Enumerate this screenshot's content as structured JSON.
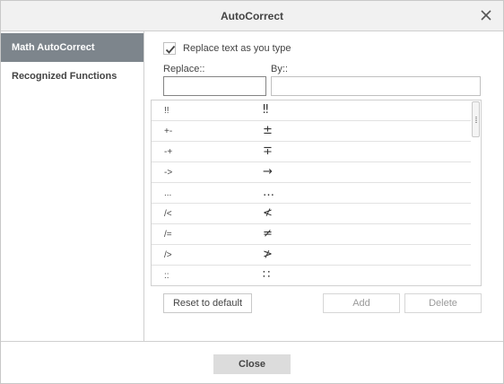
{
  "dialog": {
    "title": "AutoCorrect"
  },
  "sidebar": {
    "items": [
      {
        "label": "Math AutoCorrect",
        "active": true
      },
      {
        "label": "Recognized Functions",
        "active": false
      }
    ]
  },
  "options": {
    "replace_as_you_type_label": "Replace text as you type",
    "replace_as_you_type_checked": true
  },
  "fields": {
    "replace_label": "Replace::",
    "by_label": "By::",
    "replace_value": "",
    "by_value": ""
  },
  "table": {
    "rows": [
      {
        "replace": "!!",
        "by": "‼"
      },
      {
        "replace": "+-",
        "by": "±"
      },
      {
        "replace": "-+",
        "by": "∓"
      },
      {
        "replace": "->",
        "by": "→"
      },
      {
        "replace": "...",
        "by": "…"
      },
      {
        "replace": "/<",
        "by": "≮"
      },
      {
        "replace": "/=",
        "by": "≠"
      },
      {
        "replace": "/>",
        "by": "≯"
      },
      {
        "replace": "::",
        "by": "∷"
      }
    ]
  },
  "buttons": {
    "reset": "Reset to default",
    "add": "Add",
    "delete": "Delete",
    "close": "Close"
  },
  "icons": {
    "close": "close-icon",
    "check": "checkmark-icon"
  },
  "colors": {
    "active_sidebar_bg": "#7d858c",
    "titlebar_bg": "#f1f1f1",
    "close_button_bg": "#dcdcdc"
  }
}
